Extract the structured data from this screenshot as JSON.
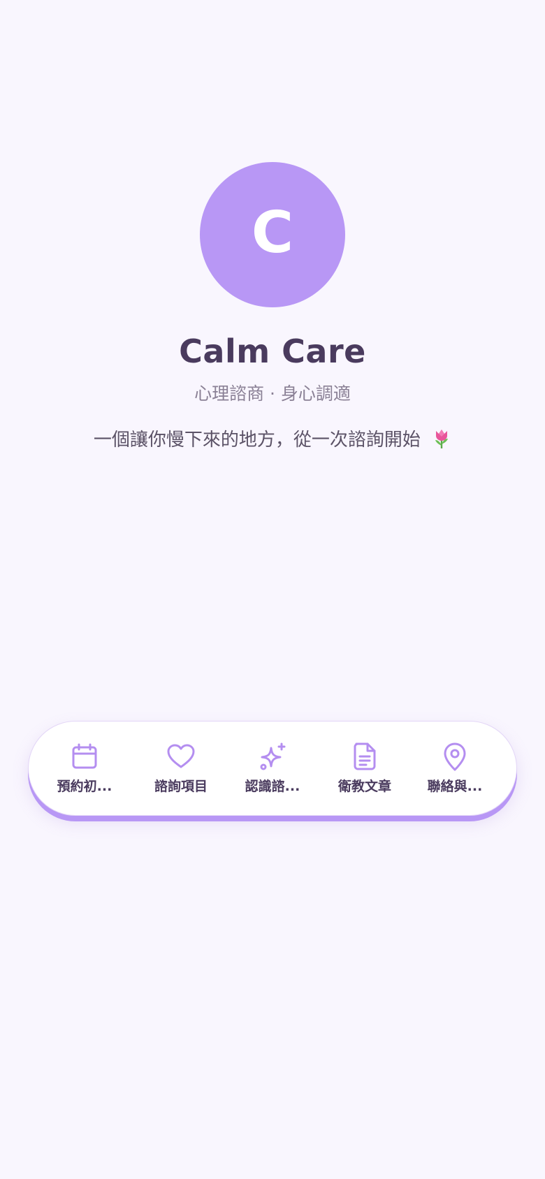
{
  "profile": {
    "avatar_letter": "C",
    "name": "Calm Care",
    "subtitle": "心理諮商 · 身心調適",
    "tagline": "一個讓你慢下來的地方，從一次諮詢開始",
    "tagline_emoji_icon": "tulip-icon"
  },
  "colors": {
    "accent": "#b897f5",
    "background": "#f9f6fe",
    "text_dark": "#4a3b5e",
    "text_muted": "#8a8095"
  },
  "nav": {
    "items": [
      {
        "label": "預約初...",
        "icon": "calendar-icon"
      },
      {
        "label": "諮詢項目",
        "icon": "heart-icon"
      },
      {
        "label": "認識諮...",
        "icon": "sparkles-icon"
      },
      {
        "label": "衛教文章",
        "icon": "document-icon"
      },
      {
        "label": "聯絡與...",
        "icon": "map-pin-icon"
      }
    ]
  }
}
